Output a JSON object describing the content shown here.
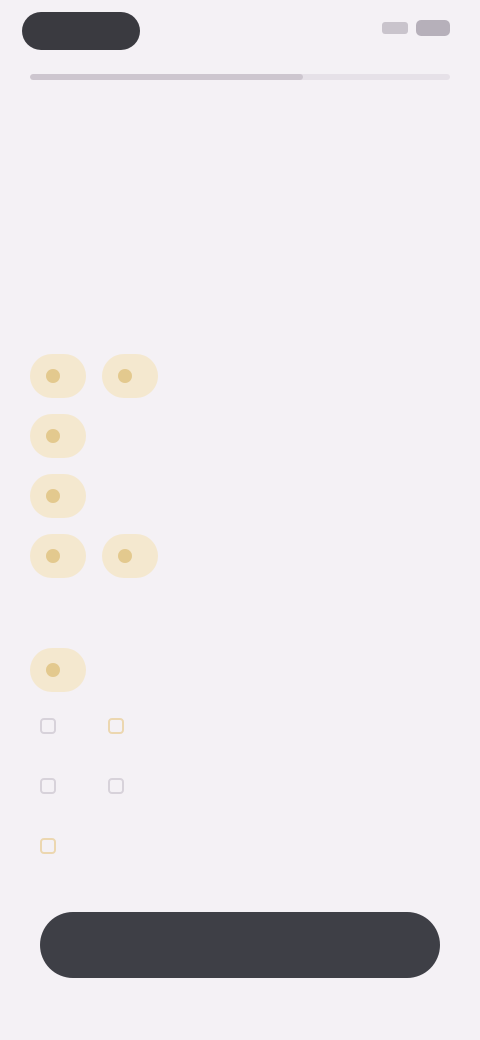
{
  "status_bar": {
    "time": "",
    "signal_icon": "signal-icon",
    "battery_icon": "battery-icon"
  },
  "progress": {
    "fraction": 0.65
  },
  "title": "",
  "subtitle": "",
  "sections": [
    {
      "label": "",
      "chip_rows": [
        [
          {
            "label": ""
          },
          {
            "label": ""
          }
        ],
        [
          {
            "label": ""
          }
        ],
        [
          {
            "label": ""
          }
        ],
        [
          {
            "label": ""
          },
          {
            "label": ""
          }
        ]
      ]
    },
    {
      "label": "",
      "chip_rows": [
        [
          {
            "label": ""
          }
        ]
      ],
      "option_rows": [
        [
          {
            "label": ""
          },
          {
            "label": ""
          }
        ],
        [
          {
            "label": ""
          },
          {
            "label": ""
          }
        ],
        [
          {
            "label": ""
          }
        ]
      ]
    }
  ],
  "continue_label": ""
}
